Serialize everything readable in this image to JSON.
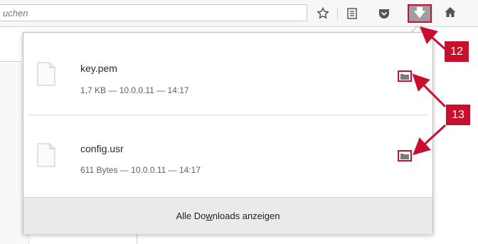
{
  "toolbar": {
    "search_placeholder": "uchen",
    "icons": [
      "star-icon",
      "reading-list-icon",
      "pocket-icon",
      "download-icon",
      "home-icon"
    ]
  },
  "downloads": {
    "items": [
      {
        "name": "key.pem",
        "meta": "1,7 KB — 10.0.0.11 — 14:17"
      },
      {
        "name": "config.usr",
        "meta": "611 Bytes — 10.0.0.11 — 14:17"
      }
    ],
    "footer_pre": "Alle Do",
    "footer_u": "w",
    "footer_post": "nloads anzeigen"
  },
  "callouts": {
    "download_button": "12",
    "folder_buttons": "13"
  },
  "colors": {
    "accent_red": "#c8102e",
    "panel_bg": "#ffffff",
    "footer_bg": "#eaeaea"
  }
}
